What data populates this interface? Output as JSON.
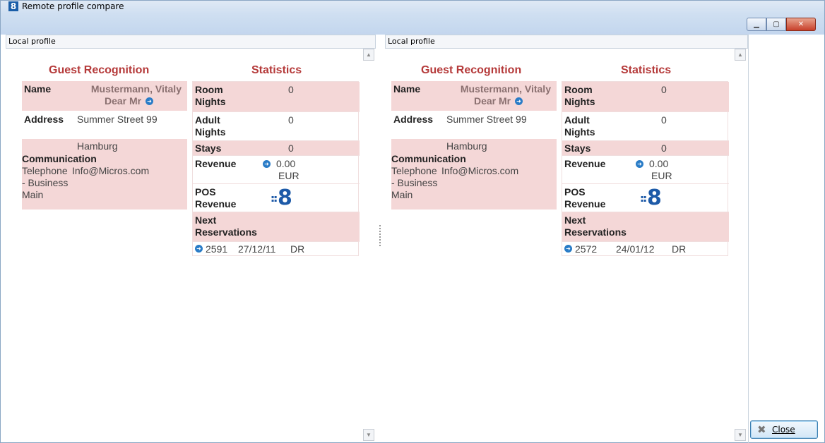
{
  "window": {
    "icon": "8",
    "title": "Remote profile compare",
    "buttons": {
      "minimize": "▁",
      "maximize": "▢",
      "close": "✕"
    }
  },
  "panels": [
    {
      "header": "Local profile",
      "guest_title": "Guest Recognition",
      "stats_title": "Statistics",
      "name_label": "Name",
      "name_value": "Mustermann, Vitaly",
      "salutation": "Dear Mr",
      "address_label": "Address",
      "address_line1": "Summer Street 99",
      "address_line2": "Hamburg",
      "communication_label": "Communication",
      "comm_type": "Telephone - Business Main",
      "comm_type_l1": "Telephone",
      "comm_type_l2": "- Business",
      "comm_type_l3": "Main",
      "comm_value": "Info@Micros.com",
      "room_nights_l1": "Room",
      "room_nights_l2": "Nights",
      "room_nights": "0",
      "adult_nights_l1": "Adult",
      "adult_nights_l2": "Nights",
      "adult_nights": "0",
      "stays_label": "Stays",
      "stays": "0",
      "revenue_label": "Revenue",
      "revenue": "0.00",
      "currency": "EUR",
      "pos_l1": "POS",
      "pos_l2": "Revenue",
      "next_l1": "Next",
      "next_l2": "Reservations",
      "res_number": "2591",
      "res_date": "27/12/11",
      "res_code": "DR"
    },
    {
      "header": "Local profile",
      "guest_title": "Guest Recognition",
      "stats_title": "Statistics",
      "name_label": "Name",
      "name_value": "Mustermann, Vitaly",
      "salutation": "Dear Mr",
      "address_label": "Address",
      "address_line1": "Summer Street 99",
      "address_line2": "Hamburg",
      "communication_label": "Communication",
      "comm_type_l1": "Telephone",
      "comm_type_l2": "- Business",
      "comm_type_l3": "Main",
      "comm_value": "Info@Micros.com",
      "room_nights_l1": "Room",
      "room_nights_l2": "Nights",
      "room_nights": "0",
      "adult_nights_l1": "Adult",
      "adult_nights_l2": "Nights",
      "adult_nights": "0",
      "stays_label": "Stays",
      "stays": "0",
      "revenue_label": "Revenue",
      "revenue": "0.00",
      "currency": "EUR",
      "pos_l1": "POS",
      "pos_l2": "Revenue",
      "next_l1": "Next",
      "next_l2": "Reservations",
      "res_number": "2572",
      "res_date": "24/01/12",
      "res_code": "DR"
    }
  ],
  "scroll": {
    "up": "▲",
    "down": "▼"
  },
  "pos_logo": "8",
  "close_button": {
    "label": "Close",
    "icon": "close-x-icon",
    "glyph": "✖"
  }
}
